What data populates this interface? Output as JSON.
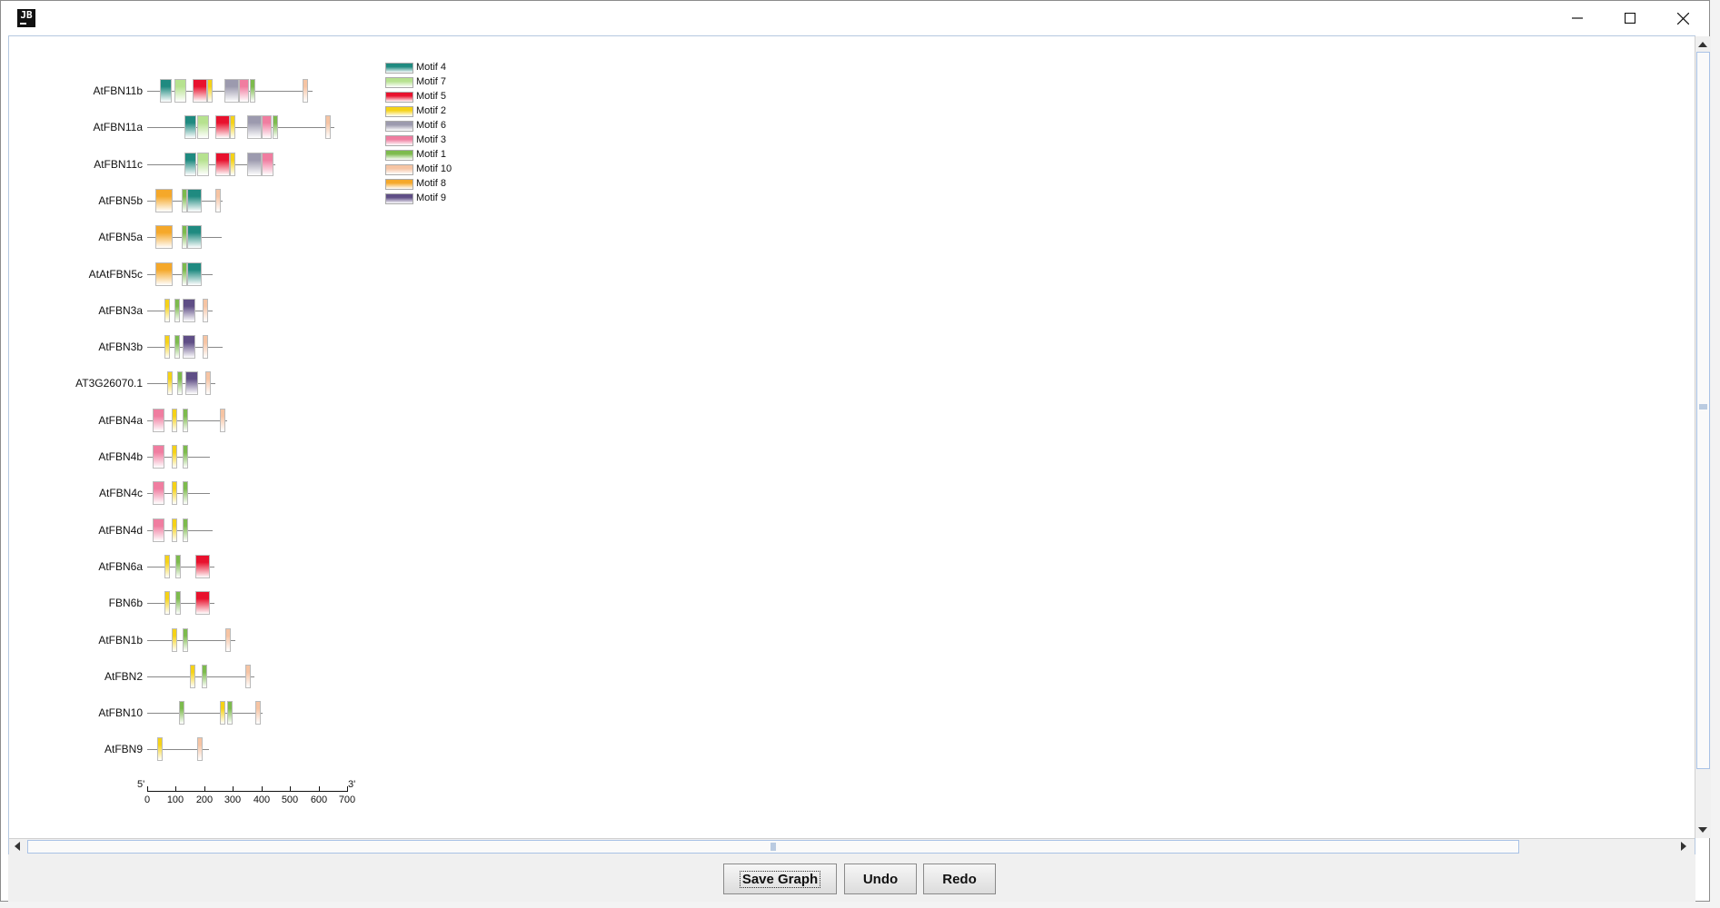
{
  "window": {
    "icon_text": "JB",
    "buttons": [
      "minimize",
      "maximize",
      "close"
    ]
  },
  "genes": [
    {
      "name": "AtFBN11b",
      "length": 580,
      "motifs": [
        {
          "id": "Motif 4",
          "start": 45,
          "width": 40
        },
        {
          "id": "Motif 7",
          "start": 95,
          "width": 40
        },
        {
          "id": "Motif 5",
          "start": 160,
          "width": 50
        },
        {
          "id": "Motif 2",
          "start": 210,
          "width": 15
        },
        {
          "id": "Motif 6",
          "start": 270,
          "width": 50
        },
        {
          "id": "Motif 3",
          "start": 320,
          "width": 35
        },
        {
          "id": "Motif 1",
          "start": 360,
          "width": 20
        },
        {
          "id": "Motif 10",
          "start": 545,
          "width": 20
        }
      ]
    },
    {
      "name": "AtFBN11a",
      "length": 655,
      "motifs": [
        {
          "id": "Motif 4",
          "start": 130,
          "width": 40
        },
        {
          "id": "Motif 7",
          "start": 175,
          "width": 40
        },
        {
          "id": "Motif 5",
          "start": 240,
          "width": 50
        },
        {
          "id": "Motif 2",
          "start": 290,
          "width": 15
        },
        {
          "id": "Motif 6",
          "start": 350,
          "width": 50
        },
        {
          "id": "Motif 3",
          "start": 400,
          "width": 35
        },
        {
          "id": "Motif 1",
          "start": 440,
          "width": 20
        },
        {
          "id": "Motif 10",
          "start": 625,
          "width": 20
        }
      ]
    },
    {
      "name": "AtFBN11c",
      "length": 450,
      "motifs": [
        {
          "id": "Motif 4",
          "start": 130,
          "width": 40
        },
        {
          "id": "Motif 7",
          "start": 175,
          "width": 40
        },
        {
          "id": "Motif 5",
          "start": 240,
          "width": 50
        },
        {
          "id": "Motif 2",
          "start": 290,
          "width": 15
        },
        {
          "id": "Motif 6",
          "start": 350,
          "width": 50
        },
        {
          "id": "Motif 3",
          "start": 400,
          "width": 40
        }
      ]
    },
    {
      "name": "AtFBN5b",
      "length": 265,
      "motifs": [
        {
          "id": "Motif 8",
          "start": 30,
          "width": 60
        },
        {
          "id": "Motif 1",
          "start": 120,
          "width": 15
        },
        {
          "id": "Motif 4",
          "start": 140,
          "width": 50
        },
        {
          "id": "Motif 10",
          "start": 240,
          "width": 20
        }
      ]
    },
    {
      "name": "AtFBN5a",
      "length": 260,
      "motifs": [
        {
          "id": "Motif 8",
          "start": 30,
          "width": 60
        },
        {
          "id": "Motif 1",
          "start": 120,
          "width": 15
        },
        {
          "id": "Motif 4",
          "start": 140,
          "width": 50
        }
      ]
    },
    {
      "name": "AtAtFBN5c",
      "length": 230,
      "motifs": [
        {
          "id": "Motif 8",
          "start": 30,
          "width": 60
        },
        {
          "id": "Motif 1",
          "start": 120,
          "width": 15
        },
        {
          "id": "Motif 4",
          "start": 140,
          "width": 50
        }
      ]
    },
    {
      "name": "AtFBN3a",
      "length": 230,
      "motifs": [
        {
          "id": "Motif 2",
          "start": 60,
          "width": 20
        },
        {
          "id": "Motif 1",
          "start": 95,
          "width": 20
        },
        {
          "id": "Motif 9",
          "start": 125,
          "width": 45
        },
        {
          "id": "Motif 10",
          "start": 195,
          "width": 20
        }
      ]
    },
    {
      "name": "AtFBN3b",
      "length": 265,
      "motifs": [
        {
          "id": "Motif 2",
          "start": 60,
          "width": 20
        },
        {
          "id": "Motif 1",
          "start": 95,
          "width": 20
        },
        {
          "id": "Motif 9",
          "start": 125,
          "width": 45
        },
        {
          "id": "Motif 10",
          "start": 195,
          "width": 20
        }
      ]
    },
    {
      "name": "AT3G26070.1",
      "length": 240,
      "motifs": [
        {
          "id": "Motif 2",
          "start": 70,
          "width": 20
        },
        {
          "id": "Motif 1",
          "start": 105,
          "width": 20
        },
        {
          "id": "Motif 9",
          "start": 135,
          "width": 45
        },
        {
          "id": "Motif 10",
          "start": 205,
          "width": 20
        }
      ]
    },
    {
      "name": "AtFBN4a",
      "length": 280,
      "motifs": [
        {
          "id": "Motif 3",
          "start": 20,
          "width": 40
        },
        {
          "id": "Motif 2",
          "start": 85,
          "width": 20
        },
        {
          "id": "Motif 1",
          "start": 125,
          "width": 20
        },
        {
          "id": "Motif 10",
          "start": 255,
          "width": 20
        }
      ]
    },
    {
      "name": "AtFBN4b",
      "length": 220,
      "motifs": [
        {
          "id": "Motif 3",
          "start": 20,
          "width": 40
        },
        {
          "id": "Motif 2",
          "start": 85,
          "width": 20
        },
        {
          "id": "Motif 1",
          "start": 125,
          "width": 20
        }
      ]
    },
    {
      "name": "AtFBN4c",
      "length": 220,
      "motifs": [
        {
          "id": "Motif 3",
          "start": 20,
          "width": 40
        },
        {
          "id": "Motif 2",
          "start": 85,
          "width": 20
        },
        {
          "id": "Motif 1",
          "start": 125,
          "width": 20
        }
      ]
    },
    {
      "name": "AtFBN4d",
      "length": 230,
      "motifs": [
        {
          "id": "Motif 3",
          "start": 20,
          "width": 40
        },
        {
          "id": "Motif 2",
          "start": 85,
          "width": 20
        },
        {
          "id": "Motif 1",
          "start": 125,
          "width": 20
        }
      ]
    },
    {
      "name": "AtFBN6a",
      "length": 235,
      "motifs": [
        {
          "id": "Motif 2",
          "start": 60,
          "width": 20
        },
        {
          "id": "Motif 1",
          "start": 100,
          "width": 20
        },
        {
          "id": "Motif 5",
          "start": 170,
          "width": 50
        }
      ]
    },
    {
      "name": "FBN6b",
      "length": 235,
      "motifs": [
        {
          "id": "Motif 2",
          "start": 60,
          "width": 20
        },
        {
          "id": "Motif 1",
          "start": 100,
          "width": 20
        },
        {
          "id": "Motif 5",
          "start": 170,
          "width": 50
        }
      ]
    },
    {
      "name": "AtFBN1b",
      "length": 310,
      "motifs": [
        {
          "id": "Motif 2",
          "start": 85,
          "width": 20
        },
        {
          "id": "Motif 1",
          "start": 125,
          "width": 20
        },
        {
          "id": "Motif 10",
          "start": 275,
          "width": 20
        }
      ]
    },
    {
      "name": "AtFBN2",
      "length": 375,
      "motifs": [
        {
          "id": "Motif 2",
          "start": 150,
          "width": 20
        },
        {
          "id": "Motif 1",
          "start": 190,
          "width": 20
        },
        {
          "id": "Motif 10",
          "start": 345,
          "width": 20
        }
      ]
    },
    {
      "name": "AtFBN10",
      "length": 405,
      "motifs": [
        {
          "id": "Motif 1",
          "start": 110,
          "width": 20
        },
        {
          "id": "Motif 2",
          "start": 255,
          "width": 20
        },
        {
          "id": "Motif 1",
          "start": 280,
          "width": 20
        },
        {
          "id": "Motif 10",
          "start": 380,
          "width": 20
        }
      ]
    },
    {
      "name": "AtFBN9",
      "length": 215,
      "motifs": [
        {
          "id": "Motif 2",
          "start": 35,
          "width": 20
        },
        {
          "id": "Motif 10",
          "start": 175,
          "width": 20
        }
      ]
    }
  ],
  "legend": [
    {
      "label": "Motif 4",
      "color": "#1f8a80"
    },
    {
      "label": "Motif 7",
      "color": "#b6e28f"
    },
    {
      "label": "Motif 5",
      "color": "#e8112d"
    },
    {
      "label": "Motif 2",
      "color": "#f5d217"
    },
    {
      "label": "Motif 6",
      "color": "#9c9aae"
    },
    {
      "label": "Motif 3",
      "color": "#f07da0"
    },
    {
      "label": "Motif 1",
      "color": "#7dbb4d"
    },
    {
      "label": "Motif 10",
      "color": "#f6c4a3"
    },
    {
      "label": "Motif 8",
      "color": "#f5a82a"
    },
    {
      "label": "Motif 9",
      "color": "#5f4e86"
    }
  ],
  "axis": {
    "start_label": "5'",
    "end_label": "3'",
    "ticks": [
      "0",
      "100",
      "200",
      "300",
      "400",
      "500",
      "600",
      "700"
    ]
  },
  "buttons": {
    "save": "Save Graph",
    "undo": "Undo",
    "redo": "Redo"
  }
}
